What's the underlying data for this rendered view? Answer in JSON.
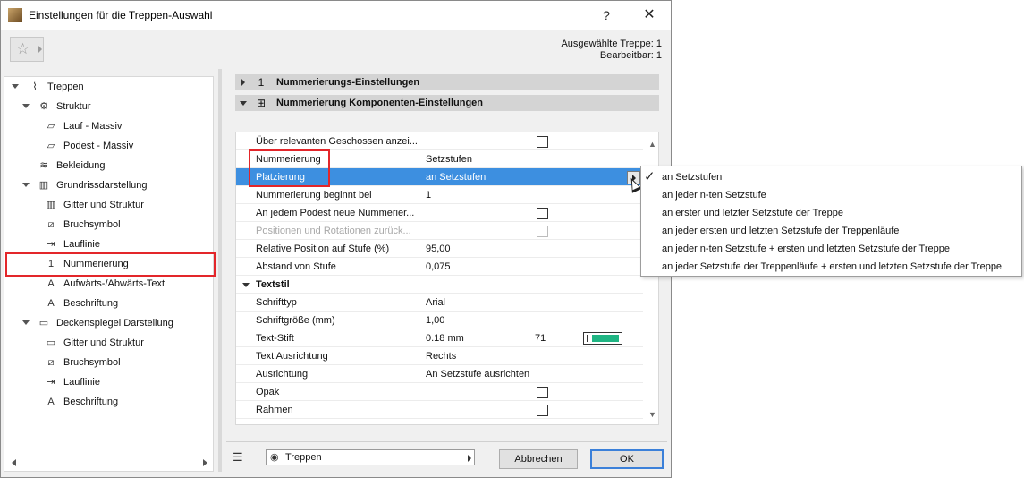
{
  "window": {
    "title": "Einstellungen für die Treppen-Auswahl",
    "help_label": "?",
    "close_label": "✕"
  },
  "info": {
    "selected": "Ausgewählte Treppe: 1",
    "editable": "Bearbeitbar: 1"
  },
  "tree": [
    {
      "label": "Treppen",
      "icon": "stair-icon",
      "glyph": "⌇"
    },
    {
      "label": "Struktur",
      "icon": "structure-icon",
      "glyph": "⚙"
    },
    {
      "label": "Lauf - Massiv",
      "icon": "flight-icon",
      "glyph": "▱"
    },
    {
      "label": "Podest - Massiv",
      "icon": "landing-icon",
      "glyph": "▱"
    },
    {
      "label": "Bekleidung",
      "icon": "cladding-icon",
      "glyph": "≋"
    },
    {
      "label": "Grundrissdarstellung",
      "icon": "floorplan-icon",
      "glyph": "▥"
    },
    {
      "label": "Gitter und Struktur",
      "icon": "grid-icon",
      "glyph": "▥"
    },
    {
      "label": "Bruchsymbol",
      "icon": "break-mark-icon",
      "glyph": "⧄"
    },
    {
      "label": "Lauflinie",
      "icon": "walking-line-icon",
      "glyph": "⇥"
    },
    {
      "label": "Nummerierung",
      "icon": "numbering-icon",
      "glyph": "1"
    },
    {
      "label": "Aufwärts-/Abwärts-Text",
      "icon": "up-down-text-icon",
      "glyph": "A"
    },
    {
      "label": "Beschriftung",
      "icon": "label-icon",
      "glyph": "A"
    },
    {
      "label": "Deckenspiegel Darstellung",
      "icon": "ceiling-plan-icon",
      "glyph": "▭"
    },
    {
      "label": "Gitter und Struktur",
      "icon": "grid-icon",
      "glyph": "▭"
    },
    {
      "label": "Bruchsymbol",
      "icon": "break-mark-icon",
      "glyph": "⧄"
    },
    {
      "label": "Lauflinie",
      "icon": "walking-line-icon",
      "glyph": "⇥"
    },
    {
      "label": "Beschriftung",
      "icon": "label-icon",
      "glyph": "A"
    }
  ],
  "sections": {
    "numbering_settings": "Nummerierungs-Einstellungen",
    "component_settings": "Nummerierung Komponenten-Einstellungen"
  },
  "properties": [
    {
      "label": "Über relevanten Geschossen anzei...",
      "type": "checkbox",
      "checked": false
    },
    {
      "label": "Nummerierung",
      "value": "Setzstufen"
    },
    {
      "label": "Platzierung",
      "value": "an Setzstufen",
      "selected": true
    },
    {
      "label": "Nummerierung beginnt bei",
      "value": "1"
    },
    {
      "label": "An jedem Podest neue Nummerier...",
      "type": "checkbox",
      "checked": false
    },
    {
      "label": "Positionen und Rotationen zurück...",
      "type": "checkbox",
      "checked": false,
      "disabled": true
    },
    {
      "label": "Relative Position auf Stufe (%)",
      "value": "95,00"
    },
    {
      "label": "Abstand von Stufe",
      "value": "0,075"
    },
    {
      "label": "Textstil",
      "type": "group"
    },
    {
      "label": "Schrifttyp",
      "value": "Arial"
    },
    {
      "label": "Schriftgröße (mm)",
      "value": "1,00"
    },
    {
      "label": "Text-Stift",
      "value": "0.18 mm",
      "pen_number": "71",
      "pen_color": "#1fb583"
    },
    {
      "label": "Text Ausrichtung",
      "value": "Rechts"
    },
    {
      "label": "Ausrichtung",
      "value": "An Setzstufe ausrichten"
    },
    {
      "label": "Opak",
      "type": "checkbox",
      "checked": false
    },
    {
      "label": "Rahmen",
      "type": "checkbox",
      "checked": false
    }
  ],
  "popup": [
    {
      "label": "an Setzstufen",
      "checked": true
    },
    {
      "label": "an jeder n-ten Setzstufe"
    },
    {
      "label": "an erster und letzter Setzstufe der Treppe"
    },
    {
      "label": "an jeder ersten und letzten Setzstufe der Treppenläufe"
    },
    {
      "label": "an jeder n-ten Setzstufe + ersten und letzten Setzstufe der Treppe"
    },
    {
      "label": "an jeder Setzstufe der Treppenläufe + ersten und letzten Setzstufe der Treppe"
    }
  ],
  "footer": {
    "layer": "Treppen",
    "cancel": "Abbrechen",
    "ok": "OK"
  },
  "colors": {
    "selection": "#3d8fe0",
    "highlight_box": "#e3262a",
    "pen": "#1fb583"
  }
}
